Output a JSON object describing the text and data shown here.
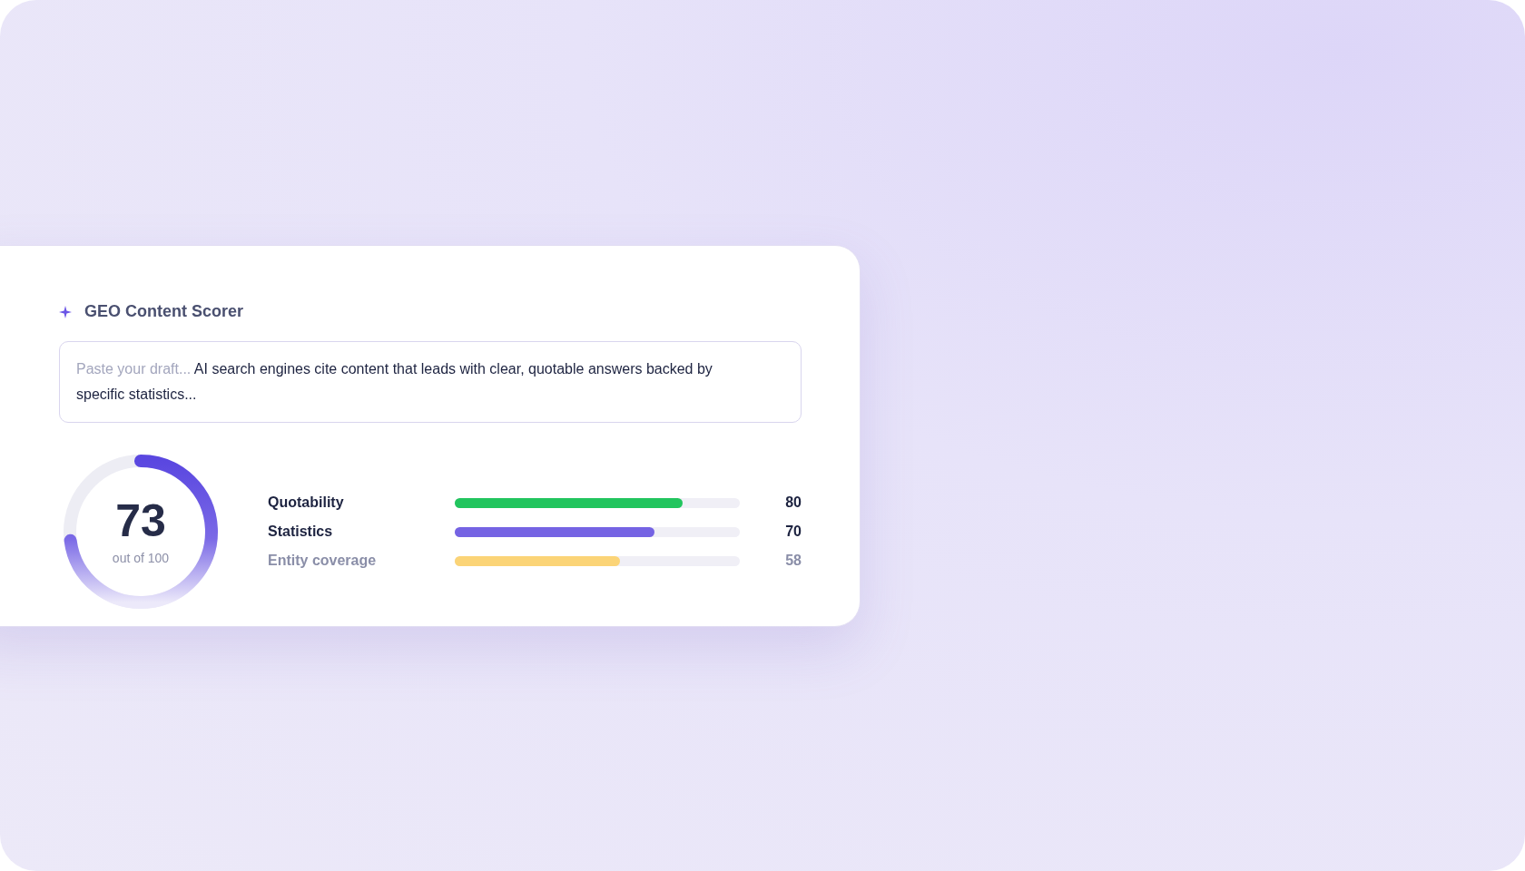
{
  "card": {
    "title": "GEO Content Scorer",
    "draft": {
      "hint": "Paste your draft...",
      "text": "AI search engines cite content that leads with clear, quotable answers backed by specific statistics..."
    },
    "score": {
      "value": "73",
      "caption": "out of 100"
    },
    "metrics": [
      {
        "label": "Quotability",
        "level": 0.8,
        "value": "80",
        "color": "#22c55e",
        "faded": false
      },
      {
        "label": "Statistics",
        "level": 0.7,
        "value": "70",
        "color": "#7563e3",
        "faded": false
      },
      {
        "label": "Entity coverage",
        "level": 0.58,
        "value": "58",
        "color": "#fbd477",
        "faded": true
      }
    ]
  }
}
